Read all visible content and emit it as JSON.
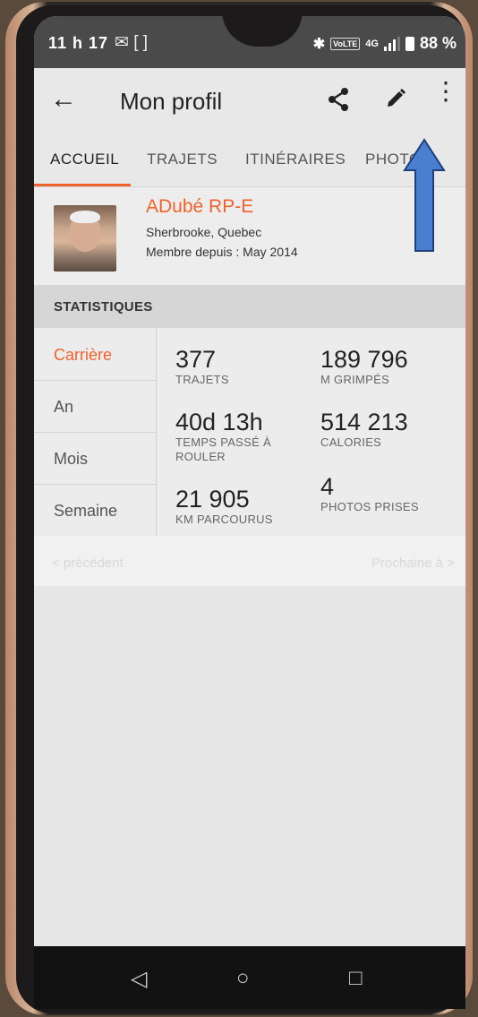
{
  "status_bar": {
    "time": "11 h 17",
    "left_icons": "✉ [ ]",
    "network": "4G",
    "battery": "88 %"
  },
  "app_bar": {
    "title": "Mon profil"
  },
  "tabs": [
    "ACCUEIL",
    "TRAJETS",
    "ITINÉRAIRES",
    "PHOTOS"
  ],
  "profile": {
    "name": "ADubé RP-E",
    "city": "Sherbrooke, Quebec",
    "member_since": "Membre depuis : May 2014"
  },
  "stats": {
    "header": "STATISTIQUES",
    "periods": [
      "Carrière",
      "An",
      "Mois",
      "Semaine"
    ],
    "items": [
      {
        "value": "377",
        "label": "TRAJETS"
      },
      {
        "value": "189 796",
        "label": "M GRIMPÉS"
      },
      {
        "value": "40d 13h",
        "label": "TEMPS PASSÉ À ROULER"
      },
      {
        "value": "514 213",
        "label": "CALORIES"
      },
      {
        "value": "21 905",
        "label": "KM PARCOURUS"
      },
      {
        "value": "4",
        "label": "PHOTOS PRISES"
      }
    ]
  },
  "pager": {
    "prev": "< précédent",
    "next": "Prochaine à >"
  },
  "colors": {
    "accent": "#f0622b",
    "arrow": "#4a7fd0"
  }
}
